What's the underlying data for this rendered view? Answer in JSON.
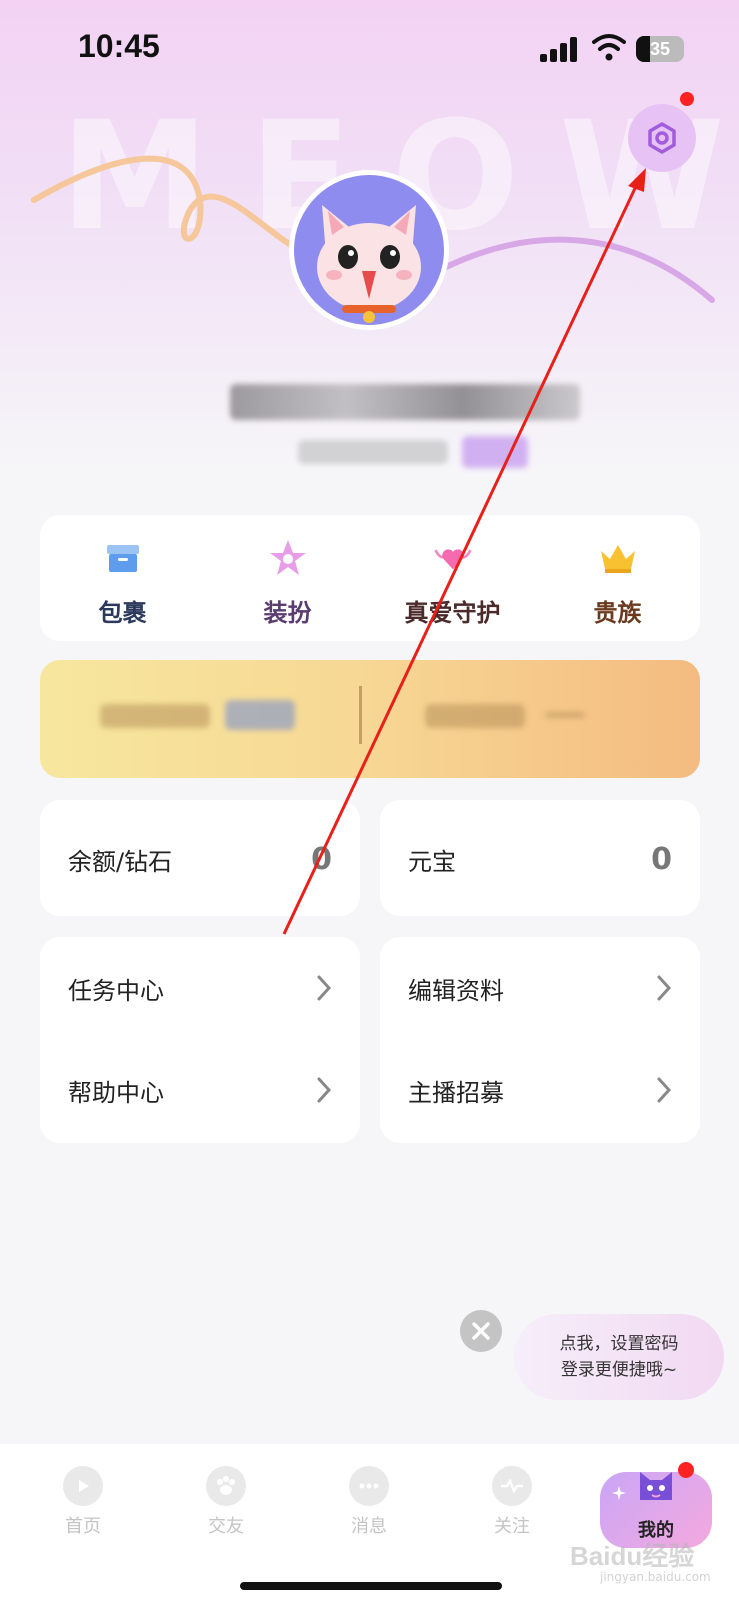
{
  "status_bar": {
    "time": "10:45",
    "battery": "35"
  },
  "header": {
    "decor_text": "MEOW"
  },
  "quick_actions": [
    {
      "label": "包裹",
      "icon": "package-icon",
      "color": "#2b3a5c"
    },
    {
      "label": "装扮",
      "icon": "star-outfit-icon",
      "color": "#5a3d6e"
    },
    {
      "label": "真爱守护",
      "icon": "heart-wings-icon",
      "color": "#4a2a2a"
    },
    {
      "label": "贵族",
      "icon": "crown-icon",
      "color": "#6b3a1e"
    }
  ],
  "balances": {
    "diamond_label": "余额/钻石",
    "diamond_value": "0",
    "yuanbao_label": "元宝",
    "yuanbao_value": "0"
  },
  "menu": {
    "left": [
      {
        "label": "任务中心"
      },
      {
        "label": "帮助中心"
      }
    ],
    "right": [
      {
        "label": "编辑资料"
      },
      {
        "label": "主播招募"
      }
    ]
  },
  "tip": {
    "line1": "点我，设置密码",
    "line2": "登录更便捷哦~"
  },
  "tab_bar": [
    {
      "label": "首页",
      "icon": "play-icon"
    },
    {
      "label": "交友",
      "icon": "paw-icon"
    },
    {
      "label": "消息",
      "icon": "chat-icon"
    },
    {
      "label": "关注",
      "icon": "heartbeat-icon"
    },
    {
      "label": "我的",
      "icon": "cat-icon"
    }
  ],
  "watermark": {
    "main": "Baidu经验",
    "sub": "jingyan.baidu.com"
  },
  "colors": {
    "accent": "#9a5ad8",
    "annotation": "#e8201a"
  }
}
